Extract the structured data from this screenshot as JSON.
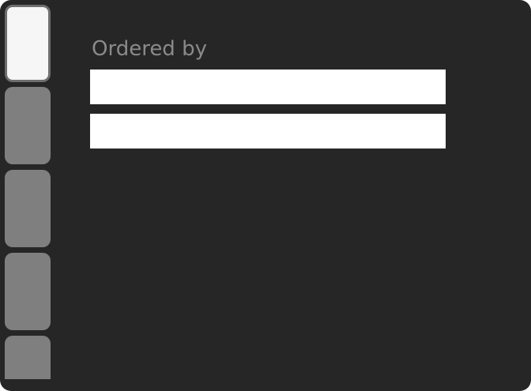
{
  "sort_panel": {
    "label": "Ordered by",
    "fields": [
      {
        "value": "",
        "placeholder": ""
      },
      {
        "value": "",
        "placeholder": ""
      }
    ]
  },
  "tabs": [
    {
      "state": "active"
    },
    {
      "state": "inactive"
    },
    {
      "state": "inactive"
    },
    {
      "state": "inactive"
    },
    {
      "state": "inactive"
    }
  ],
  "colors": {
    "window_background": "#262626",
    "tab_active": "#f6f6f6",
    "tab_inactive": "#7f7f7f",
    "label_text": "#8a8a8a",
    "field_background": "#ffffff"
  }
}
